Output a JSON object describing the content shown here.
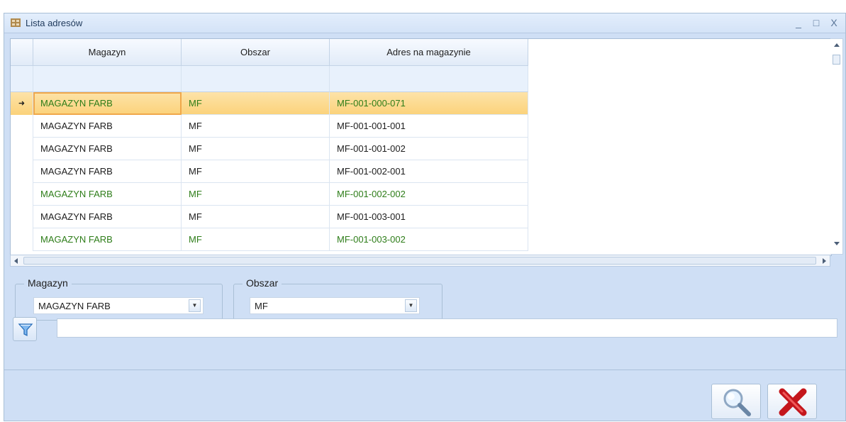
{
  "window": {
    "title": "Lista adresów",
    "minimize_glyph": "_",
    "maximize_glyph": "□",
    "close_glyph": "X"
  },
  "grid": {
    "columns": [
      "Magazyn",
      "Obszar",
      "Adres na magazynie"
    ],
    "rows": [
      {
        "magazyn": "MAGAZYN FARB",
        "obszar": "MF",
        "adres": "MF-001-000-071",
        "selected": true,
        "color": "#2e7d19"
      },
      {
        "magazyn": "MAGAZYN FARB",
        "obszar": "MF",
        "adres": "MF-001-001-001",
        "selected": false,
        "color": "#1e1e1e"
      },
      {
        "magazyn": "MAGAZYN FARB",
        "obszar": "MF",
        "adres": "MF-001-001-002",
        "selected": false,
        "color": "#1e1e1e"
      },
      {
        "magazyn": "MAGAZYN FARB",
        "obszar": "MF",
        "adres": "MF-001-002-001",
        "selected": false,
        "color": "#1e1e1e"
      },
      {
        "magazyn": "MAGAZYN FARB",
        "obszar": "MF",
        "adres": "MF-001-002-002",
        "selected": false,
        "color": "#2e7d19"
      },
      {
        "magazyn": "MAGAZYN FARB",
        "obszar": "MF",
        "adres": "MF-001-003-001",
        "selected": false,
        "color": "#1e1e1e"
      },
      {
        "magazyn": "MAGAZYN FARB",
        "obszar": "MF",
        "adres": "MF-001-003-002",
        "selected": false,
        "color": "#2e7d19"
      }
    ],
    "row_indicator_glyph": "➜"
  },
  "filters": {
    "magazyn_label": "Magazyn",
    "magazyn_value": "MAGAZYN FARB",
    "obszar_label": "Obszar",
    "obszar_value": "MF",
    "text_filter_value": ""
  },
  "icons": {
    "filter": "funnel-icon",
    "search": "magnifier-icon",
    "cancel": "red-x-icon"
  },
  "colors": {
    "selected_row": "#fbd27a",
    "green_text": "#2e7d19",
    "panel": "#cfdff5"
  }
}
